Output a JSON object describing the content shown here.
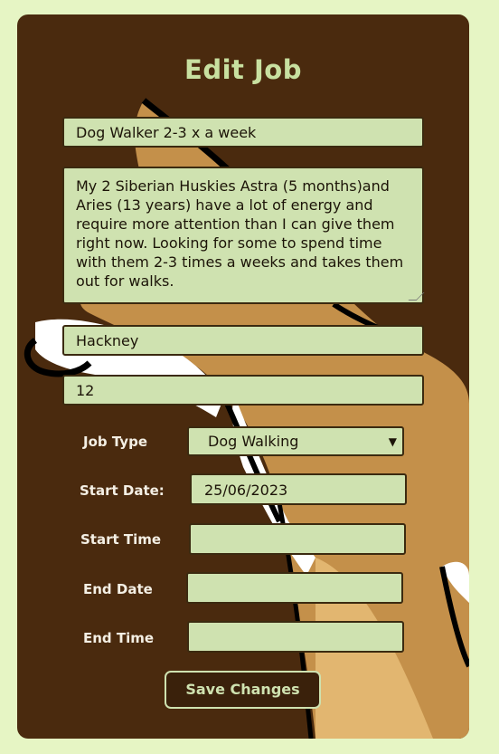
{
  "form": {
    "title": "Edit Job",
    "job_title_value": "Dog Walker 2-3 x a week",
    "description_value": "My 2 Siberian Huskies Astra (5 months)and Aries (13 years) have a lot of energy and require more attention than I can give them right now. Looking for some to spend time with them 2-3 times a weeks and takes them out for walks.",
    "location_value": "Hackney",
    "pay_value": "12",
    "job_type": {
      "label": "Job Type",
      "selected": "Dog Walking"
    },
    "start_date": {
      "label": "Start Date:",
      "value": "25/06/2023"
    },
    "start_time": {
      "label": "Start Time",
      "value": ""
    },
    "end_date": {
      "label": "End Date",
      "value": ""
    },
    "end_time": {
      "label": "End Time",
      "value": ""
    },
    "save_label": "Save Changes"
  },
  "colors": {
    "page_bg": "#e6f5c4",
    "card_bg": "#4a2a0e",
    "field_bg": "#cfe2b0",
    "title_color": "#c8e0a0",
    "button_bg": "#3a210b"
  },
  "icons": {
    "select": "chevron-down-icon"
  }
}
